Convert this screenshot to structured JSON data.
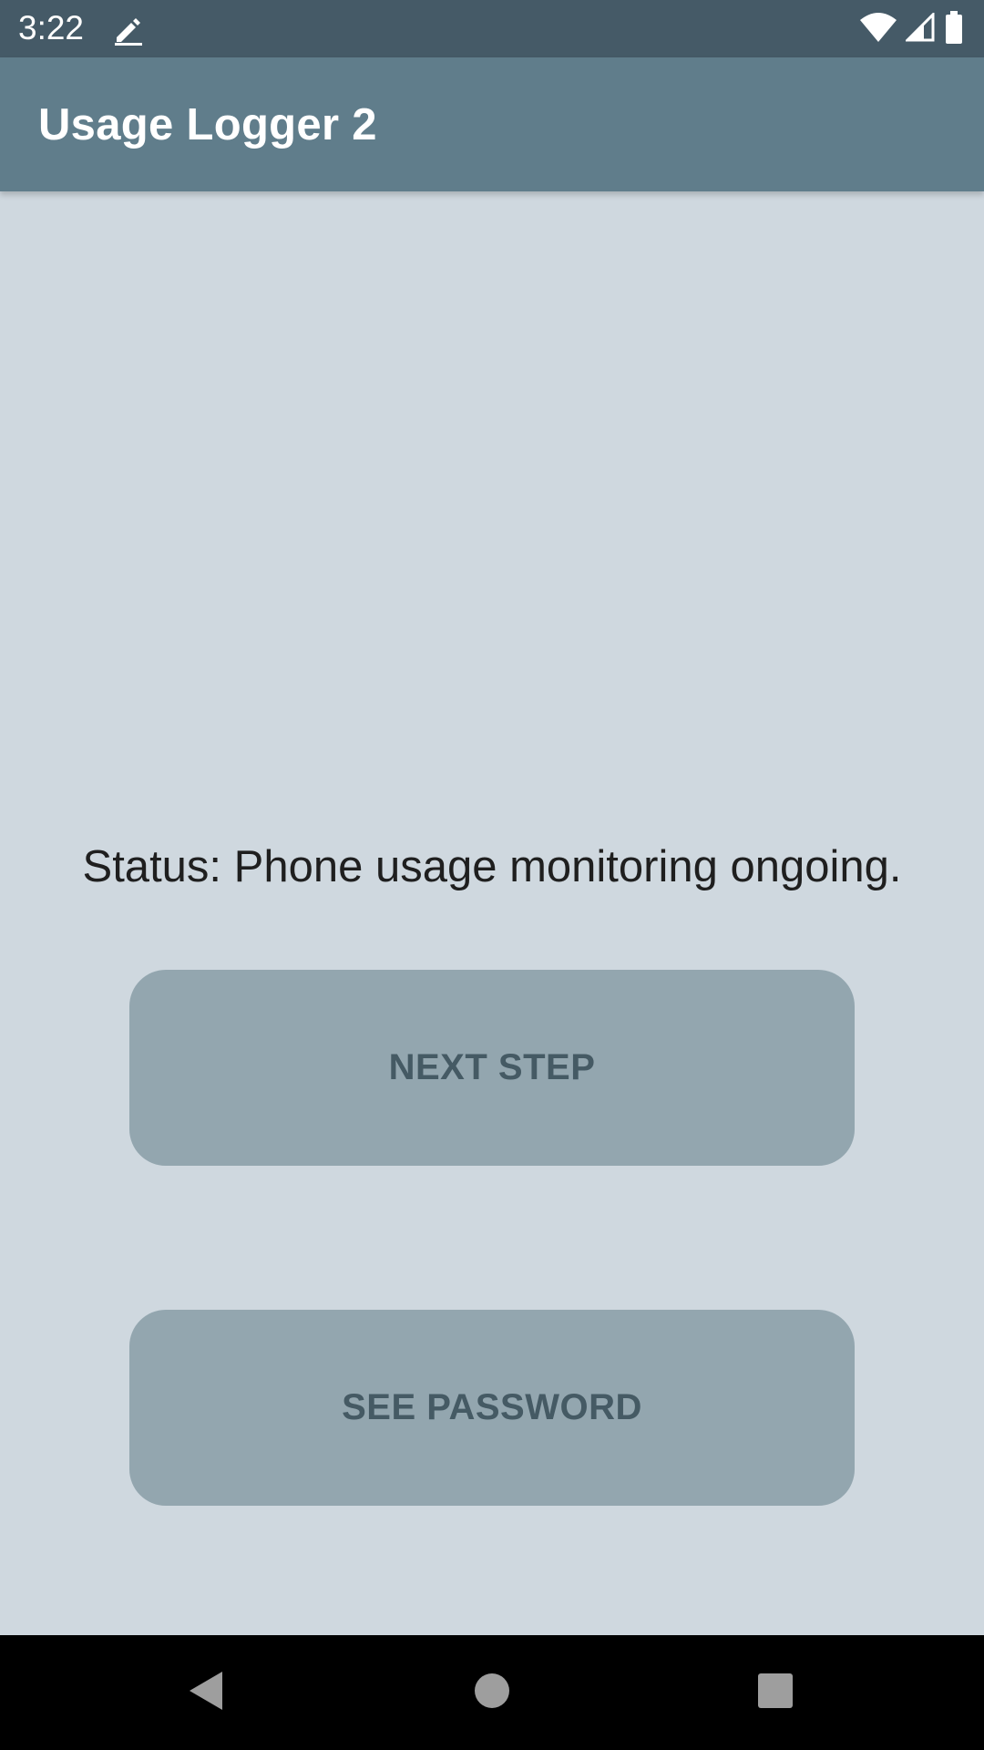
{
  "status_bar": {
    "time": "3:22",
    "icons": [
      "edit-icon",
      "wifi-icon",
      "cellular-signal-icon",
      "battery-icon"
    ]
  },
  "app_bar": {
    "title": "Usage Logger 2"
  },
  "main": {
    "status_text": "Status: Phone usage monitoring ongoing.",
    "next_step_label": "NEXT STEP",
    "see_password_label": "SEE PASSWORD"
  },
  "nav_bar": {
    "icons": [
      "back-icon",
      "home-icon",
      "recents-icon"
    ]
  },
  "colors": {
    "status_bar": "#455a67",
    "app_bar": "#607d8b",
    "background": "#cfd8df",
    "button_fill": "#93a6af",
    "button_text": "#455a64",
    "nav_bar": "#000000"
  }
}
